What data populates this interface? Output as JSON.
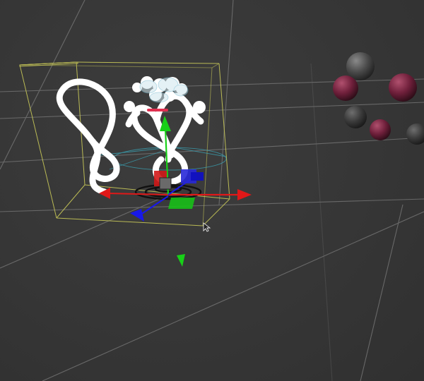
{
  "viewport": {
    "background_color": "#383838",
    "grid_color": "#7a7a7a"
  },
  "selection": {
    "bounding_box_color": "#c8c858"
  },
  "gizmo": {
    "x_axis_color": "#e01818",
    "y_axis_color": "#18d018",
    "z_axis_color": "#1818e8",
    "center_handle": "move-handle"
  },
  "objects": {
    "knot_curve": {
      "color": "#ffffff"
    },
    "spheres": [
      {
        "tint": "#8a2a4a"
      },
      {
        "tint": "#5a5a5a"
      },
      {
        "tint": "#8a2a4a"
      },
      {
        "tint": "#4a4a4a"
      },
      {
        "tint": "#8a2a4a"
      },
      {
        "tint": "#4a4a4a"
      },
      {
        "tint": "#5a5a5a"
      }
    ]
  },
  "cursor": {
    "icon": "arrow-pointer-icon"
  }
}
